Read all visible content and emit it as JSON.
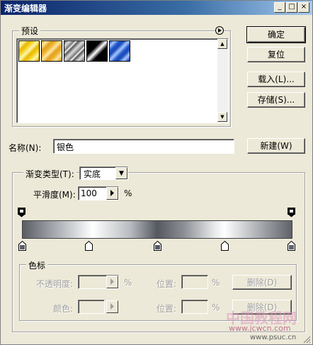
{
  "window": {
    "title": "渐变编辑器"
  },
  "titlebar_buttons": {
    "minimize": "_",
    "maximize": "□",
    "close": "×"
  },
  "presets": {
    "label": "预设"
  },
  "buttons": {
    "ok": "确定",
    "reset": "复位",
    "load": "载入(L)...",
    "save": "存储(S)...",
    "new": "新建(W)",
    "delete1": "删除(D)",
    "delete2": "删除(D)"
  },
  "name": {
    "label": "名称(N):",
    "value": "银色"
  },
  "gradient_type": {
    "label": "渐变类型(T):",
    "value": "实底"
  },
  "smoothness": {
    "label": "平滑度(M):",
    "value": "100",
    "unit": "%"
  },
  "color_stops": {
    "label": "色标",
    "opacity_label": "不透明度:",
    "opacity_unit": "%",
    "location_label_1": "位置:",
    "location_unit_1": "%",
    "color_label": "颜色:",
    "location_label_2": "位置:",
    "location_unit_2": "%"
  },
  "watermark": {
    "line1": "中国教程网",
    "line2": "www.jcwcn.com",
    "line3": "www.psuc.cn"
  }
}
